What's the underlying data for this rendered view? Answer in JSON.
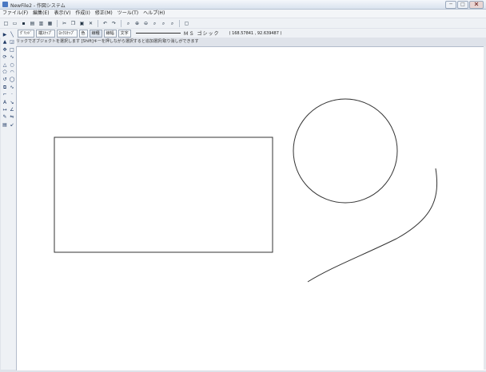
{
  "window": {
    "title": "NewFile2 - 作図システム",
    "buttons": [
      "─",
      "□"
    ]
  },
  "menu": [
    "ファイル(F)",
    "編集(E)",
    "表示(V)",
    "作成(I)",
    "修正(M)",
    "ツール(T)",
    "ヘルプ(H)"
  ],
  "toolbar1": [
    {
      "name": "new-icon",
      "glyph": "□"
    },
    {
      "name": "open-icon",
      "glyph": "▭"
    },
    {
      "name": "save-icon",
      "glyph": "▪"
    },
    {
      "name": "print-icon",
      "glyph": "▤"
    },
    {
      "name": "print-preview-icon",
      "glyph": "▥"
    },
    {
      "name": "page-setup-icon",
      "glyph": "▦"
    },
    {
      "name": "cut-icon",
      "glyph": "✂"
    },
    {
      "name": "copy-icon",
      "glyph": "❐"
    },
    {
      "name": "paste-icon",
      "glyph": "▣"
    },
    {
      "name": "delete-icon",
      "glyph": "✕"
    },
    {
      "name": "undo-icon",
      "glyph": "↶"
    },
    {
      "name": "redo-icon",
      "glyph": "↷"
    },
    {
      "name": "zoom-window-icon",
      "glyph": "⌕"
    },
    {
      "name": "zoom-in-icon",
      "glyph": "⊕"
    },
    {
      "name": "zoom-out-icon",
      "glyph": "⊖"
    },
    {
      "name": "zoom-all-icon",
      "glyph": "⌕"
    },
    {
      "name": "zoom-fit-icon",
      "glyph": "⌕"
    },
    {
      "name": "zoom-previous-icon",
      "glyph": "⌕"
    },
    {
      "name": "redraw-icon",
      "glyph": "▢"
    }
  ],
  "toolbar2": {
    "buttons": [
      "ｸﾞﾘｯﾄﾞ",
      "端ｽﾅｯﾌﾟ",
      "ﾛｯｸｽﾅｯﾌﾟ",
      "色",
      "線種",
      "線幅",
      "文字"
    ],
    "font": "ＭＳ ゴシック",
    "coords": "( 168.57841 , 92.639487 )"
  },
  "status": "左クリックでオブジェクトを選択します [Shift]キーを押しながら選択すると追加選択/取り消しができます",
  "tools": [
    {
      "name": "select-tool",
      "glyph": "▶"
    },
    {
      "name": "line-tool",
      "glyph": "╲"
    },
    {
      "name": "pointer-tool",
      "glyph": "▲"
    },
    {
      "name": "pick-tool",
      "glyph": "◲"
    },
    {
      "name": "move-tool",
      "glyph": "✥"
    },
    {
      "name": "rectangle-tool",
      "glyph": "□"
    },
    {
      "name": "rotate-tool",
      "glyph": "⟳"
    },
    {
      "name": "curve-tool",
      "glyph": "∿"
    },
    {
      "name": "triangle-tool",
      "glyph": "△"
    },
    {
      "name": "circle-tool",
      "glyph": "○"
    },
    {
      "name": "polygon-tool",
      "glyph": "⬠"
    },
    {
      "name": "arc-tool",
      "glyph": "◠"
    },
    {
      "name": "undo-shape-tool",
      "glyph": "↺"
    },
    {
      "name": "ellipse-tool",
      "glyph": "◯"
    },
    {
      "name": "group-tool",
      "glyph": "⧉"
    },
    {
      "name": "spline-tool",
      "glyph": "∿"
    },
    {
      "name": "trim-tool",
      "glyph": "⌐"
    },
    {
      "name": "point-tool",
      "glyph": "·"
    },
    {
      "name": "text-tool",
      "glyph": "A"
    },
    {
      "name": "leader-tool",
      "glyph": "↘"
    },
    {
      "name": "dimension-tool",
      "glyph": "↦"
    },
    {
      "name": "angle-dimension-tool",
      "glyph": "∠"
    },
    {
      "name": "fill-tool",
      "glyph": "✎"
    },
    {
      "name": "mirror-tool",
      "glyph": "⇋"
    },
    {
      "name": "hatch-tool",
      "glyph": "▤"
    },
    {
      "name": "erase-tool",
      "glyph": "↙"
    }
  ]
}
